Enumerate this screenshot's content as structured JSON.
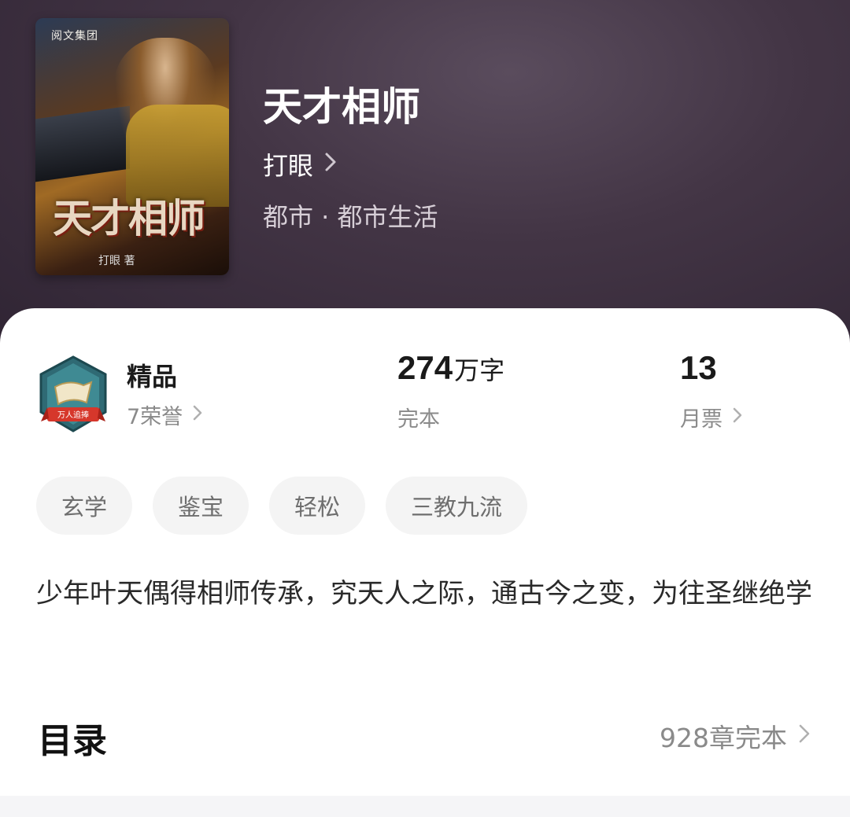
{
  "cover": {
    "publisher": "阅文集团",
    "title_art": "天才相师",
    "author_art": "打眼 著"
  },
  "book": {
    "title": "天才相师",
    "author": "打眼",
    "category": "都市 · 都市生活"
  },
  "stats": {
    "quality": {
      "title": "精品",
      "honors": "7荣誉",
      "badge_label": "万人追捧"
    },
    "words": {
      "number": "274",
      "unit": "万字",
      "status": "完本"
    },
    "monthly": {
      "number": "13",
      "label": "月票"
    }
  },
  "tags": [
    "玄学",
    "鉴宝",
    "轻松",
    "三教九流"
  ],
  "synopsis": "少年叶天偶得相师传承，究天人之际，通古今之变，为往圣继绝学",
  "toc": {
    "title": "目录",
    "info": "928章完本"
  },
  "icons": {
    "author_chevron": "chevron-right-icon",
    "honors_chevron": "chevron-right-icon",
    "monthly_chevron": "chevron-right-icon",
    "toc_chevron": "chevron-right-icon",
    "badge": "quality-badge-icon"
  },
  "colors": {
    "hero_bg": "#433545",
    "card_bg": "#ffffff",
    "tag_bg": "#f4f4f4"
  }
}
